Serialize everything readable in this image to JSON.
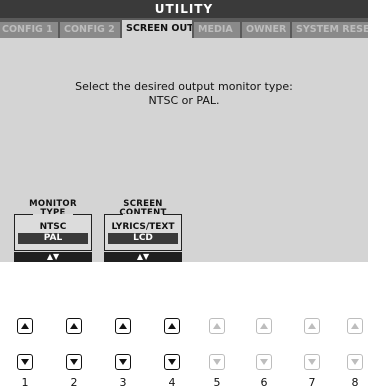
{
  "title": "UTILITY",
  "tabs": [
    "CONFIG 1",
    "CONFIG 2",
    "SCREEN OUT",
    "MEDIA",
    "OWNER",
    "SYSTEM RESET"
  ],
  "active_tab": "SCREEN OUT",
  "message": {
    "line1": "Select the desired output monitor type:",
    "line2": "NTSC or PAL."
  },
  "monitor_type": {
    "label_line1": "MONITOR",
    "label_line2": "TYPE",
    "option_1": "NTSC",
    "option_selected": "PAL",
    "arrows": "▲▼"
  },
  "screen_content": {
    "label_line1": "SCREEN",
    "label_line2": "CONTENT",
    "option_1": "LYRICS/TEXT",
    "option_selected": "LCD",
    "arrows": "▲▼"
  },
  "button_numbers": [
    "1",
    "2",
    "3",
    "4",
    "5",
    "6",
    "7",
    "8"
  ],
  "colors": {
    "screen_bg": "#d4d4d4",
    "title_bg": "#3a3a3a",
    "selected_bg": "#3a3a3a",
    "inactive_button": "#bdbdbd"
  }
}
